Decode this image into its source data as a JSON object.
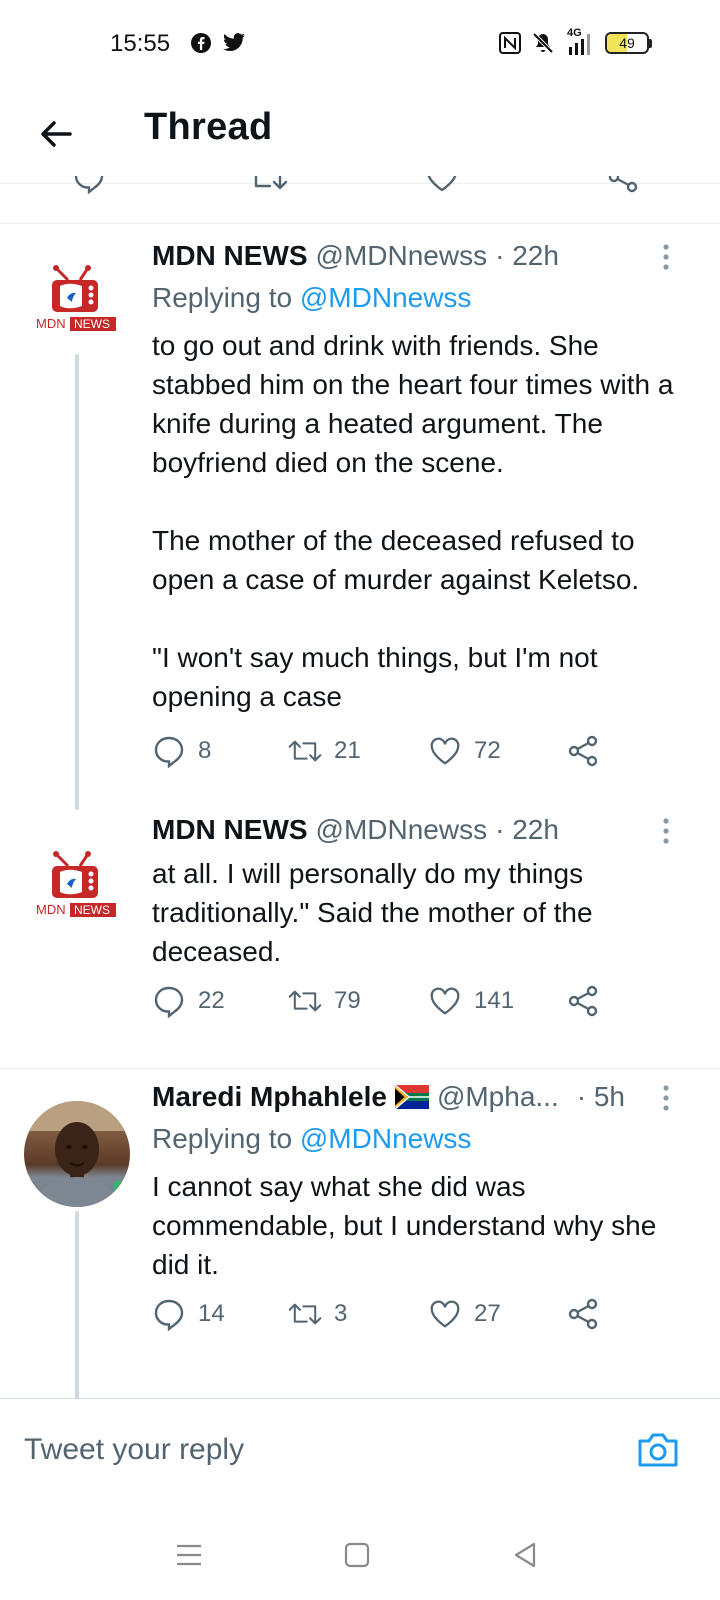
{
  "status_bar": {
    "time": "15:55",
    "left_icons": [
      "facebook-icon",
      "twitter-icon"
    ],
    "right_icons": [
      "nfc-icon",
      "mute-icon",
      "signal-4g-icon",
      "battery-icon"
    ],
    "network": "4G",
    "battery": "49",
    "battery_level": 0.49
  },
  "header": {
    "title": "Thread",
    "back_icon": "arrow-left-icon"
  },
  "tweets": [
    {
      "name": "MDN NEWS",
      "handle": "@MDNnewss",
      "time": "· 22h",
      "replying_label": "Replying to ",
      "replying_to": "@MDNnewss",
      "text": "to go out and drink with friends. She stabbed him on the heart four times with a knife during a heated argument. The boyfriend died on the scene.\n\nThe mother of the deceased refused to open a case of murder against Keletso.\n\n\"I won't say much things, but I'm not opening a case",
      "replies": "8",
      "retweets": "21",
      "likes": "72"
    },
    {
      "name": "MDN NEWS",
      "handle": "@MDNnewss",
      "time": "· 22h",
      "text": "at all. I will personally do my things traditionally.\" Said the mother of the deceased.",
      "replies": "22",
      "retweets": "79",
      "likes": "141"
    },
    {
      "name": "Maredi Mphahlele",
      "flag": "south-africa-flag-icon",
      "handle": "@Mpha...",
      "time": "· 5h",
      "replying_label": "Replying to ",
      "replying_to": "@MDNnewss",
      "text": "I cannot say what she did was commendable, but I understand why she did it.",
      "replies": "14",
      "retweets": "3",
      "likes": "27"
    }
  ],
  "logo": {
    "text_a": "MDN",
    "text_b": "NEWS"
  },
  "reply_bar": {
    "placeholder": "Tweet your reply",
    "camera_icon": "camera-icon"
  },
  "colors": {
    "accent": "#1d9bf0",
    "text": "#0f1419",
    "secondary": "#536471",
    "logo_red": "#c62828"
  }
}
